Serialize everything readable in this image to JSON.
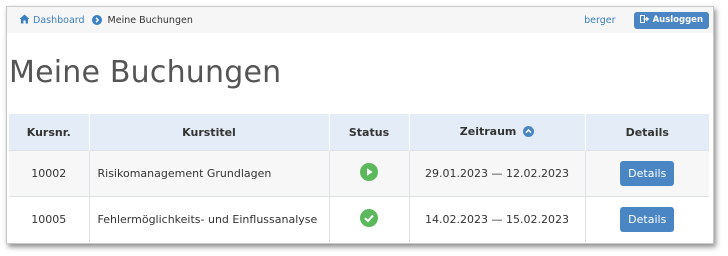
{
  "breadcrumb": {
    "home_label": "Dashboard",
    "current_label": "Meine Buchungen"
  },
  "user": {
    "name": "berger",
    "logout_label": "Ausloggen"
  },
  "page": {
    "title": "Meine Buchungen"
  },
  "table": {
    "headers": {
      "course_no": "Kursnr.",
      "course_title": "Kurstitel",
      "status": "Status",
      "period": "Zeitraum",
      "details": "Details"
    },
    "rows": [
      {
        "course_no": "10002",
        "course_title": "Risikomanagement Grundlagen",
        "status": "in-progress-icon",
        "period": "29.01.2023 — 12.02.2023",
        "details_label": "Details"
      },
      {
        "course_no": "10005",
        "course_title": "Fehlermöglichkeits- und Einflussanalyse",
        "status": "completed-icon",
        "period": "14.02.2023 — 15.02.2023",
        "details_label": "Details"
      }
    ]
  },
  "colors": {
    "accent": "#4a86c4",
    "link": "#3a7fc1",
    "status_green": "#5cb85c",
    "header_bg": "#e4edf7"
  }
}
